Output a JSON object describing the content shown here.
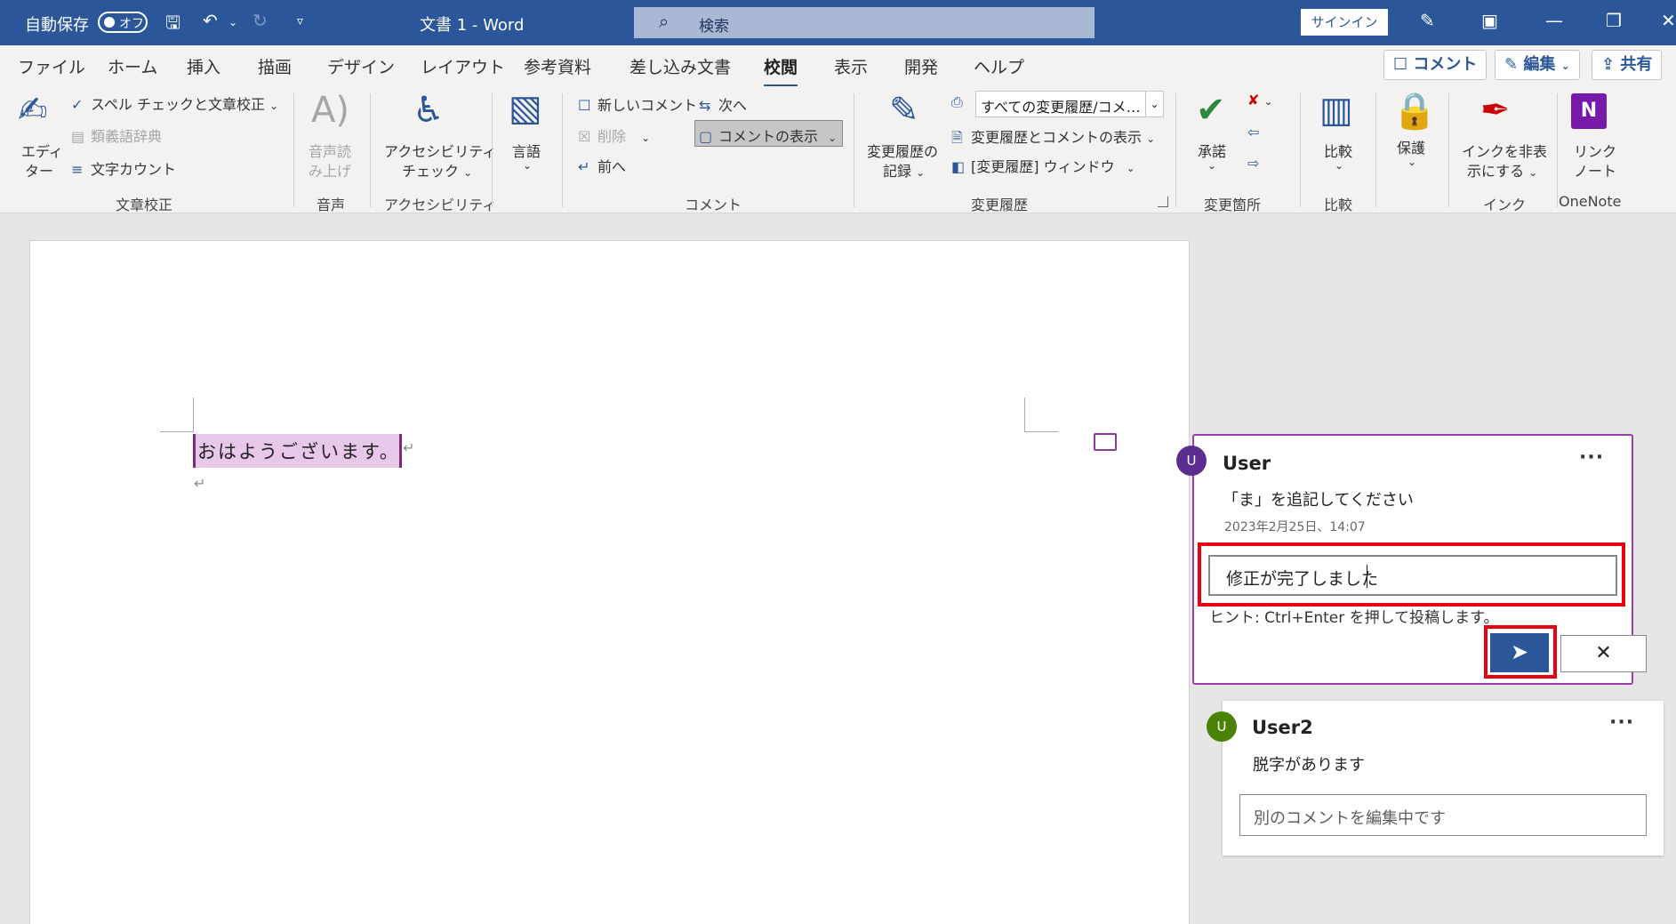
{
  "titlebar": {
    "autosave_label": "自動保存",
    "autosave_state": "オフ",
    "doc_title": "文書 1  -  Word",
    "search_placeholder": "検索",
    "signin_label": "サインイン"
  },
  "menu": {
    "tabs": [
      "ファイル",
      "ホーム",
      "挿入",
      "描画",
      "デザイン",
      "レイアウト",
      "参考資料",
      "差し込み文書",
      "校閲",
      "表示",
      "開発",
      "ヘルプ"
    ],
    "active_tab": "校閲",
    "comment_button": "コメント",
    "edit_button": "編集",
    "share_button": "共有"
  },
  "ribbon": {
    "editor_line1": "エディ",
    "editor_line2": "ター",
    "spell_check": "スペル チェックと文章校正",
    "thesaurus": "類義語辞典",
    "word_count": "文字カウント",
    "group_proofing": "文章校正",
    "read_aloud_line1": "音声読",
    "read_aloud_line2": "み上げ",
    "group_speech": "音声",
    "accessibility_line1": "アクセシビリティ",
    "accessibility_line2": "チェック",
    "group_accessibility": "アクセシビリティ",
    "language": "言語",
    "new_comment": "新しいコメント",
    "next": "次へ",
    "delete": "削除",
    "show_comments": "コメントの表示",
    "previous": "前へ",
    "group_comments": "コメント",
    "track_changes_line1": "変更履歴の",
    "track_changes_line2": "記録",
    "markup_combo": "すべての変更履歴/コメ…",
    "show_markup": "変更履歴とコメントの表示",
    "reviewing_pane": "[変更履歴] ウィンドウ",
    "group_tracking": "変更履歴",
    "accept": "承諾",
    "group_changes": "変更箇所",
    "compare": "比較",
    "group_compare": "比較",
    "protect": "保護",
    "hide_ink_line1": "インクを非表",
    "hide_ink_line2": "示にする",
    "group_ink": "インク",
    "linked_notes_line1": "リンク",
    "linked_notes_line2": "ノート",
    "group_onenote": "OneNote"
  },
  "document": {
    "text": "おはようございます。"
  },
  "comments": [
    {
      "avatar": "U",
      "avatar_color": "#5c2d91",
      "author": "User",
      "text": "「ま」を追記してください",
      "date": "2023年2月25日、14:07",
      "reply_value": "修正が完了しました",
      "hint": "ヒント: Ctrl+Enter を押して投稿します。"
    },
    {
      "avatar": "U",
      "avatar_color": "#498205",
      "author": "User2",
      "text": "脱字があります",
      "input_placeholder": "別のコメントを編集中です"
    }
  ],
  "colors": {
    "title_bar": "#2b579a",
    "highlight_box": "#e60012",
    "comment_border": "#9b3fa8"
  }
}
